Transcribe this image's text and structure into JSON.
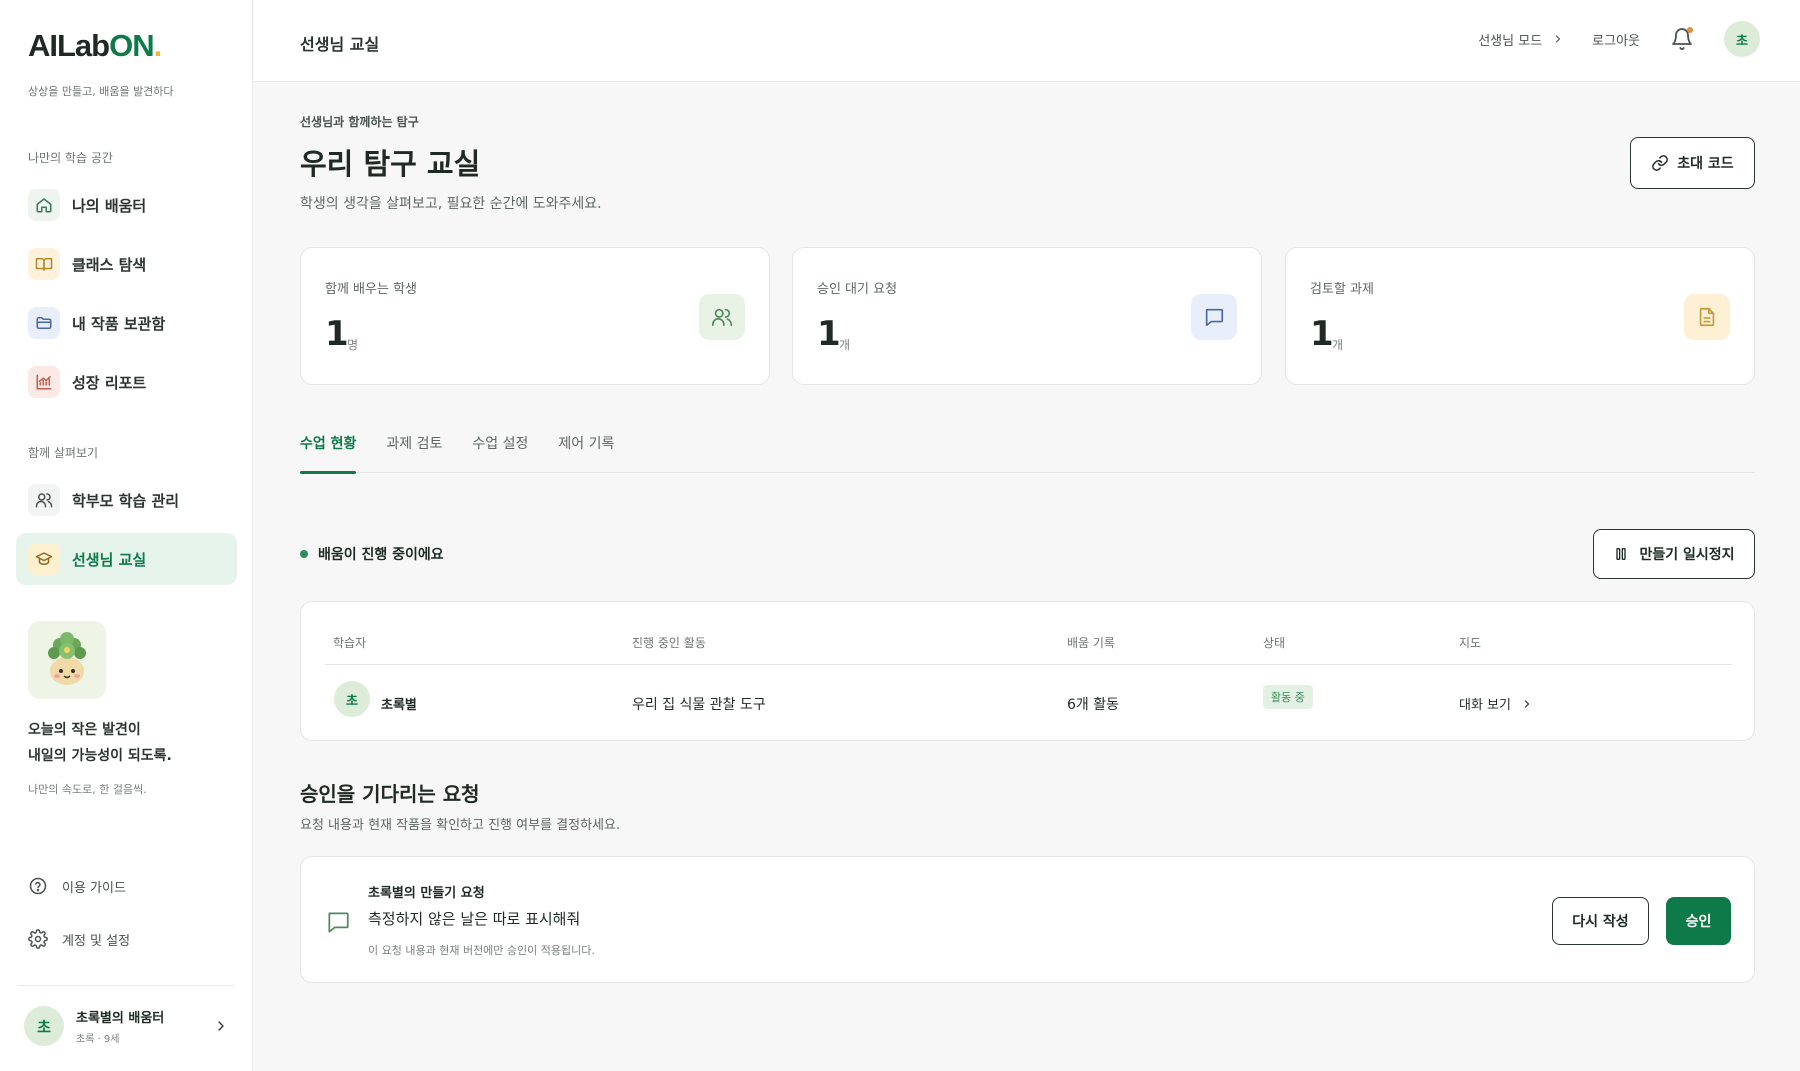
{
  "sidebar": {
    "logo": {
      "part1": "AILab",
      "part2": "ON",
      "dot": "."
    },
    "tagline": "상상을 만들고, 배움을 발견하다",
    "section1_label": "나만의 학습 공간",
    "section2_label": "함께 살펴보기",
    "items": [
      {
        "label": "나의 배움터",
        "icon": "home-icon"
      },
      {
        "label": "클래스 탐색",
        "icon": "book-icon"
      },
      {
        "label": "내 작품 보관함",
        "icon": "folder-icon"
      },
      {
        "label": "성장 리포트",
        "icon": "chart-icon"
      },
      {
        "label": "학부모 학습 관리",
        "icon": "users-icon"
      },
      {
        "label": "선생님 교실",
        "icon": "graduation-cap-icon",
        "active": true
      }
    ],
    "promo": {
      "line1": "오늘의 작은 발견이",
      "line2": "내일의 가능성이 되도록.",
      "sub": "나만의 속도로, 한 걸음씩."
    },
    "footer": [
      {
        "label": "이용 가이드",
        "icon": "help-icon"
      },
      {
        "label": "계정 및 설정",
        "icon": "gear-icon"
      }
    ],
    "profile": {
      "initial": "초",
      "name": "초록별의 배움터",
      "meta": "초록 · 9세"
    }
  },
  "topbar": {
    "title": "선생님 교실",
    "mode_label": "선생님 모드",
    "logout_label": "로그아웃",
    "avatar_initial": "초"
  },
  "main": {
    "eyebrow": "선생님과 함께하는 탐구",
    "title": "우리 탐구 교실",
    "description": "학생의 생각을 살펴보고, 필요한 순간에 도와주세요.",
    "invite_label": "초대 코드",
    "stats": [
      {
        "label": "함께 배우는 학생",
        "value": "1",
        "unit": "명",
        "icon": "users-icon"
      },
      {
        "label": "승인 대기 요청",
        "value": "1",
        "unit": "개",
        "icon": "message-icon"
      },
      {
        "label": "검토할 과제",
        "value": "1",
        "unit": "개",
        "icon": "document-icon"
      }
    ],
    "tabs": [
      "수업 현황",
      "과제 검토",
      "수업 설정",
      "제어 기록"
    ],
    "status_text": "배움이 진행 중이에요",
    "pause_label": "만들기 일시정지",
    "table": {
      "headers": [
        "학습자",
        "진행 중인 활동",
        "배움 기록",
        "상태",
        "지도"
      ],
      "rows": [
        {
          "initial": "초",
          "name": "초록별",
          "activity": "우리 집 식물 관찰 도구",
          "record": "6개 활동",
          "status": "활동 중",
          "action": "대화 보기"
        }
      ]
    },
    "requests_title": "승인을 기다리는 요청",
    "requests_desc": "요청 내용과 현재 작품을 확인하고 진행 여부를 결정하세요.",
    "request": {
      "from": "초록별의 만들기 요청",
      "text": "측정하지 않은 날은 따로 표시해줘",
      "note": "이 요청 내용과 현재 버전에만 승인이 적용됩니다.",
      "rewrite_label": "다시 작성",
      "approve_label": "승인"
    }
  },
  "colors": {
    "accent": "#0e7a4a",
    "logo_dot": "#f2b632",
    "notification": "#f08a3a"
  }
}
